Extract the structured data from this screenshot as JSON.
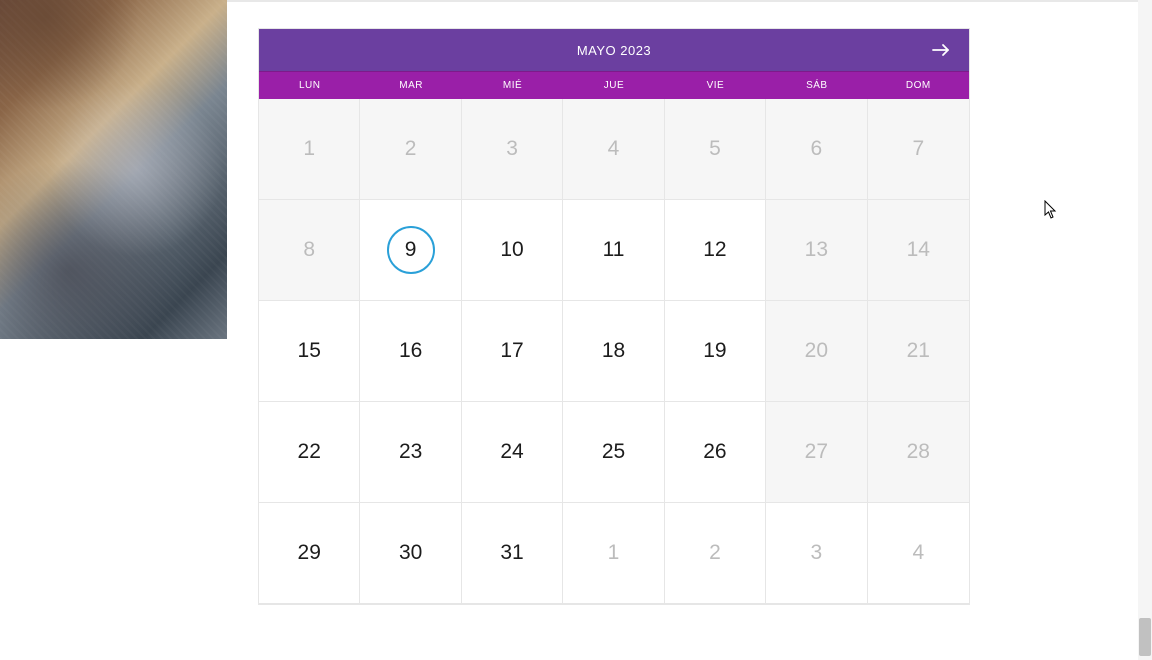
{
  "calendar": {
    "title": "MAYO 2023",
    "weekdays": [
      "LUN",
      "MAR",
      "MIÉ",
      "JUE",
      "VIE",
      "SÁB",
      "DOM"
    ],
    "weeks": [
      [
        {
          "n": "1",
          "state": "disabled"
        },
        {
          "n": "2",
          "state": "disabled"
        },
        {
          "n": "3",
          "state": "disabled"
        },
        {
          "n": "4",
          "state": "disabled"
        },
        {
          "n": "5",
          "state": "disabled"
        },
        {
          "n": "6",
          "state": "disabled"
        },
        {
          "n": "7",
          "state": "disabled"
        }
      ],
      [
        {
          "n": "8",
          "state": "disabled"
        },
        {
          "n": "9",
          "state": "today"
        },
        {
          "n": "10",
          "state": "enabled"
        },
        {
          "n": "11",
          "state": "enabled"
        },
        {
          "n": "12",
          "state": "enabled"
        },
        {
          "n": "13",
          "state": "disabled"
        },
        {
          "n": "14",
          "state": "disabled"
        }
      ],
      [
        {
          "n": "15",
          "state": "enabled"
        },
        {
          "n": "16",
          "state": "enabled"
        },
        {
          "n": "17",
          "state": "enabled"
        },
        {
          "n": "18",
          "state": "enabled"
        },
        {
          "n": "19",
          "state": "enabled"
        },
        {
          "n": "20",
          "state": "disabled"
        },
        {
          "n": "21",
          "state": "disabled"
        }
      ],
      [
        {
          "n": "22",
          "state": "enabled"
        },
        {
          "n": "23",
          "state": "enabled"
        },
        {
          "n": "24",
          "state": "enabled"
        },
        {
          "n": "25",
          "state": "enabled"
        },
        {
          "n": "26",
          "state": "enabled"
        },
        {
          "n": "27",
          "state": "disabled"
        },
        {
          "n": "28",
          "state": "disabled"
        }
      ],
      [
        {
          "n": "29",
          "state": "enabled"
        },
        {
          "n": "30",
          "state": "enabled"
        },
        {
          "n": "31",
          "state": "enabled"
        },
        {
          "n": "1",
          "state": "other-month"
        },
        {
          "n": "2",
          "state": "other-month"
        },
        {
          "n": "3",
          "state": "other-month"
        },
        {
          "n": "4",
          "state": "other-month"
        }
      ]
    ]
  }
}
